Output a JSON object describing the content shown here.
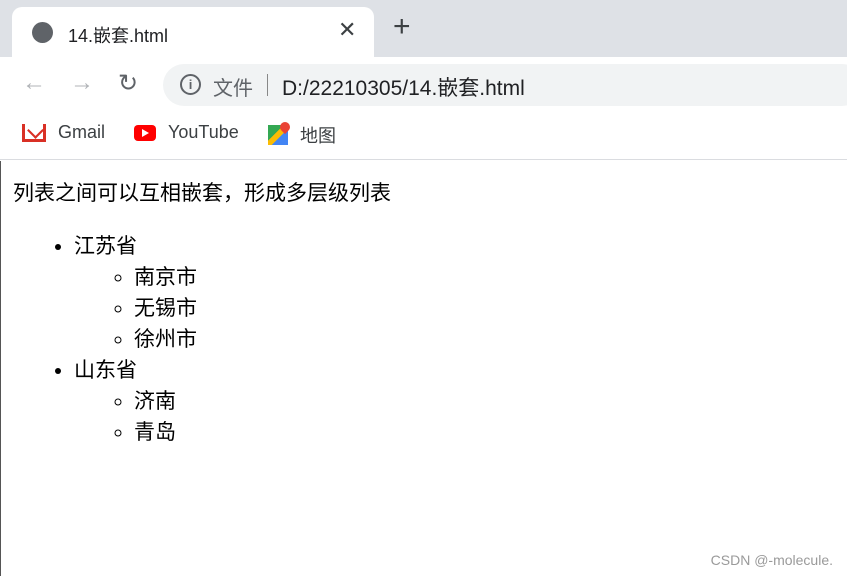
{
  "browser": {
    "tab_title": "14.嵌套.html",
    "address_scheme": "文件",
    "address_url": "D:/22210305/14.嵌套.html",
    "bookmarks": [
      {
        "label": "Gmail",
        "icon": "gmail-icon"
      },
      {
        "label": "YouTube",
        "icon": "youtube-icon"
      },
      {
        "label": "地图",
        "icon": "maps-icon"
      }
    ]
  },
  "page": {
    "intro": "列表之间可以互相嵌套，形成多层级列表",
    "list": [
      {
        "label": "江苏省",
        "children": [
          "南京市",
          "无锡市",
          "徐州市"
        ]
      },
      {
        "label": "山东省",
        "children": [
          "济南",
          "青岛"
        ]
      }
    ]
  },
  "watermark": "CSDN @-molecule."
}
